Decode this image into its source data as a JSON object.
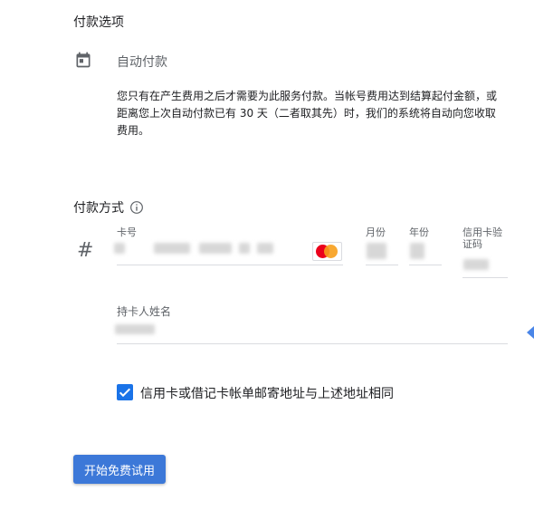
{
  "payment_options": {
    "title": "付款选项",
    "autopay_label": "自动付款",
    "description": "您只有在产生费用之后才需要为此服务付款。当帐号费用达到结算起付金额，或距离您上次自动付款已有 30 天（二者取其先）时，我们的系统将自动向您收取费用。"
  },
  "payment_method": {
    "title": "付款方式",
    "card_number_label": "卡号",
    "month_label": "月份",
    "year_label": "年份",
    "cvc_label": "信用卡验证码",
    "cardholder_label": "持卡人姓名"
  },
  "billing": {
    "same_address_label": "信用卡或借记卡帐单邮寄地址与上述地址相同",
    "same_address_checked": true
  },
  "actions": {
    "start_trial_label": "开始免费试用"
  },
  "icons": {
    "calendar": "calendar-icon",
    "info": "info-icon",
    "card_number": "hash-icon",
    "card_brand": "mastercard-icon",
    "checkbox_check": "check-icon"
  },
  "colors": {
    "accent": "#1a73e8",
    "button": "#3c78d8",
    "muted_text": "#5f6368"
  }
}
